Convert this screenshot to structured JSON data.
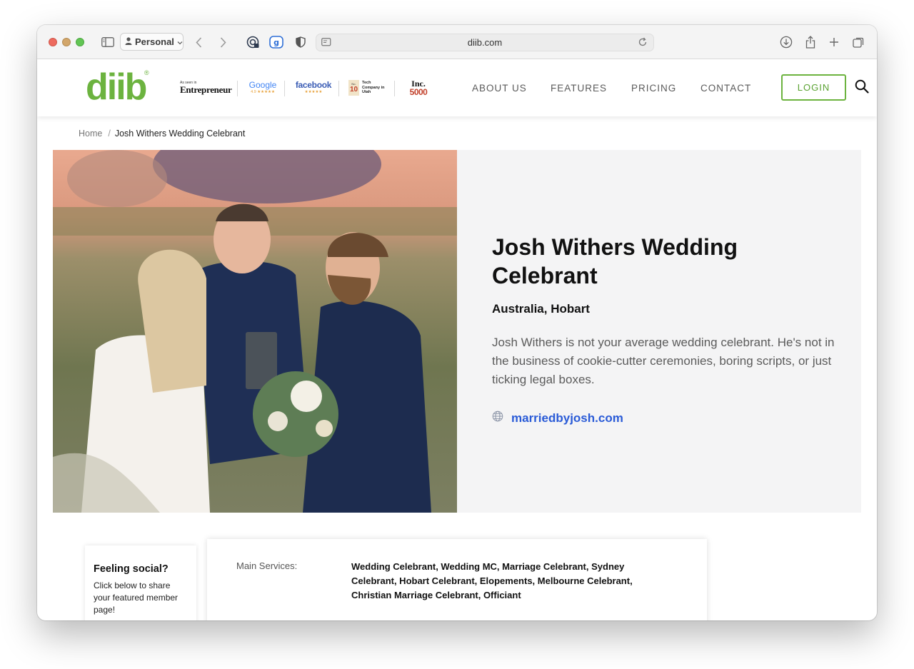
{
  "browser": {
    "profile_label": "Personal",
    "url": "diib.com",
    "icons": [
      "sidebar-icon",
      "person-icon",
      "chevron-down-icon",
      "back-icon",
      "forward-icon",
      "password-icon",
      "grammarly-icon",
      "shield-icon",
      "reader-icon",
      "reload-icon",
      "download-icon",
      "share-icon",
      "new-tab-icon",
      "tabs-overview-icon"
    ]
  },
  "site": {
    "logo": "diib",
    "logo_mark": "®",
    "press": {
      "entrepreneur_caption": "As seen in",
      "entrepreneur": "Entrepreneur",
      "google": "Google",
      "google_rating": "4.9 ★★★★★",
      "facebook": "facebook",
      "facebook_stars": "★★★★★",
      "tech_rank_small": "No.",
      "tech_rank": "10",
      "tech_text": "Tech Company in Utah",
      "inc": "Inc.",
      "inc_number": "5000"
    },
    "nav": [
      "ABOUT US",
      "FEATURES",
      "PRICING",
      "CONTACT"
    ],
    "login_label": "LOGIN"
  },
  "breadcrumb": {
    "home": "Home",
    "separator": "/",
    "current": "Josh Withers Wedding Celebrant"
  },
  "hero": {
    "title": "Josh Withers Wedding Celebrant",
    "location": "Australia, Hobart",
    "description": "Josh Withers is not your average wedding celebrant. He's not in the business of cookie-cutter ceremonies, boring scripts, or just ticking legal boxes.",
    "website": "marriedbyjosh.com"
  },
  "social": {
    "title": "Feeling social?",
    "text": "Click below to share your featured member page!"
  },
  "services": {
    "label": "Main Services:",
    "value": "Wedding Celebrant, Wedding MC, Marriage Celebrant, Sydney Celebrant, Hobart Celebrant, Elopements, Melbourne Celebrant, Christian Marriage Celebrant, Officiant"
  },
  "colors": {
    "brand_green": "#6cb33f",
    "link_blue": "#2a5bd7",
    "panel_bg": "#f4f4f5"
  }
}
